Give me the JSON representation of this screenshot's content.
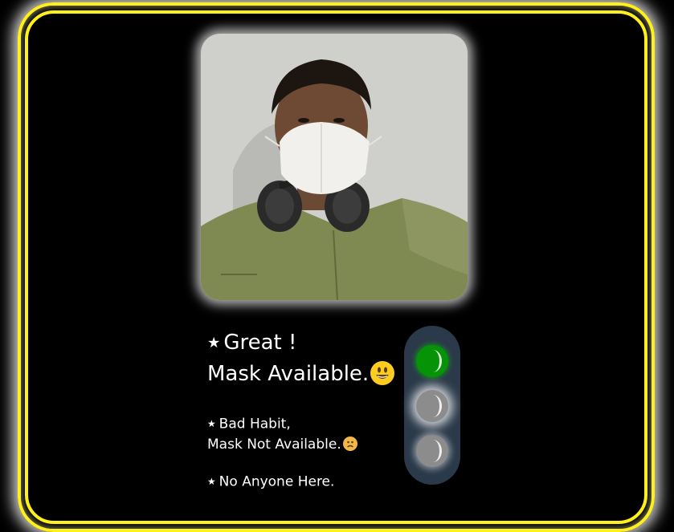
{
  "camera": {
    "icon": "camera-feed-image",
    "subject": "person-wearing-mask"
  },
  "status": {
    "great_line1": "Great !",
    "great_line2": "Mask Available.",
    "great_emoji": "grinning-face-emoji",
    "bad_line1": "Bad Habit,",
    "bad_line2": "Mask Not Available.",
    "bad_emoji": "worried-face-emoji",
    "none_line": "No Anyone Here."
  },
  "traffic_light": {
    "active": "green",
    "colors": {
      "green": "#069406",
      "inactive": "#8c8c8c",
      "housing": "#2b3a4a"
    }
  },
  "theme": {
    "frame_color": "#ffef1a",
    "background": "#000000"
  }
}
